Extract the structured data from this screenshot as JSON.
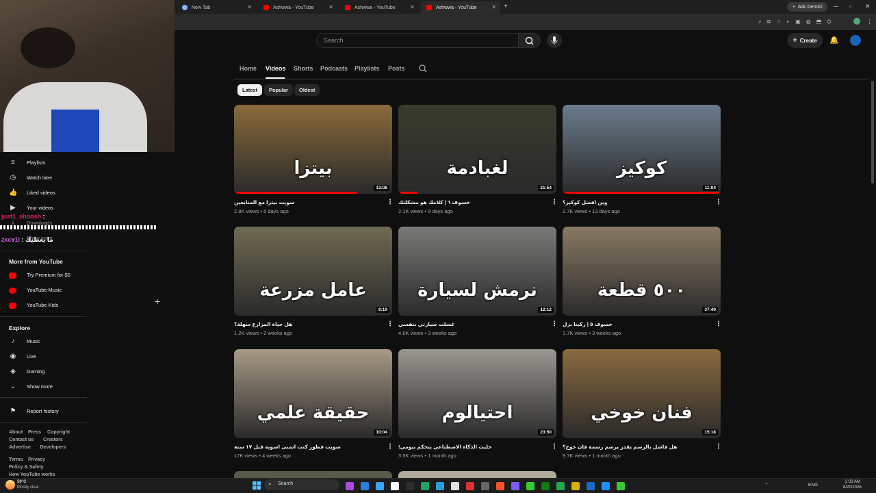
{
  "browser": {
    "tabs": [
      {
        "label": "New Tab",
        "active": false
      },
      {
        "label": "Ashwwa - YouTube",
        "active": false
      },
      {
        "label": "Ashwwa - YouTube",
        "active": false
      },
      {
        "label": "Ashwwa - YouTube",
        "active": true
      }
    ],
    "new_tab": "+",
    "ask_gemini": "Ask Gemini"
  },
  "header": {
    "search_placeholder": "Search",
    "create_label": "Create"
  },
  "channel_tabs": [
    "Home",
    "Videos",
    "Shorts",
    "Podcasts",
    "Playlists",
    "Posts"
  ],
  "active_channel_tab": "Videos",
  "chips": [
    "Latest",
    "Popular",
    "Oldest"
  ],
  "active_chip": "Latest",
  "videos": [
    {
      "overlay": "بيتزا",
      "duration": "13:08",
      "title": "سويت بيتزا مع المتابعين",
      "views": "2.8K views",
      "ago": "5 days ago",
      "thumb_color": "#8a6a3a",
      "progress": 0.78
    },
    {
      "overlay": "لغبادمة",
      "duration": "21:54",
      "title": "خسوف ٦ | كلامك هو مشكلتك",
      "views": "2.1K views",
      "ago": "9 days ago",
      "thumb_color": "#3a3b2e",
      "progress": 0.12
    },
    {
      "overlay": "كوكيز",
      "duration": "11:04",
      "title": "وين افضل كوكيز؟",
      "views": "2.7K views",
      "ago": "13 days ago",
      "thumb_color": "#6b7c8c",
      "progress": 1.0
    },
    {
      "overlay": "عامل مزرعة",
      "duration": "8:19",
      "title": "هل حياة المزارع سهلة؟",
      "views": "1.2K views",
      "ago": "2 weeks ago",
      "thumb_color": "#6f6a52",
      "progress": 0
    },
    {
      "overlay": "نرمش لسيارة",
      "duration": "12:12",
      "title": "غسلت سيارتي بنفسي",
      "views": "4.6K views",
      "ago": "3 weeks ago",
      "thumb_color": "#7a7a78",
      "progress": 0
    },
    {
      "overlay": "٥٠٠ قطعة",
      "duration": "37:49",
      "title": "خسوف ٥ | ركبنا بزل",
      "views": "1.7K views",
      "ago": "3 weeks ago",
      "thumb_color": "#8a7a64",
      "progress": 0
    },
    {
      "overlay": "حقيقة علمي",
      "duration": "10:04",
      "title": "سويت فطور كنت اتمنى اسويه قبل ١٧ سنة",
      "views": "17K views",
      "ago": "4 weeks ago",
      "thumb_color": "#a89a86",
      "progress": 0
    },
    {
      "overlay": "احتيالوم",
      "duration": "23:50",
      "title": "خليت الذكاء الاصطناعي يتحكم بيومي!",
      "views": "3.5K views",
      "ago": "1 month ago",
      "thumb_color": "#9a9690",
      "progress": 0
    },
    {
      "overlay": "فنان خوخي",
      "duration": "15:18",
      "title": "هل فاشل بالرسم يقدر يرسم رسمة فان جوخ؟",
      "views": "9.7K views",
      "ago": "1 month ago",
      "thumb_color": "#8a6a40",
      "progress": 0
    }
  ],
  "sidebar": {
    "you_items": [
      {
        "label": "Playlists",
        "icon": "≡"
      },
      {
        "label": "Watch later",
        "icon": "◷"
      },
      {
        "label": "Liked videos",
        "icon": "👍"
      },
      {
        "label": "Your videos",
        "icon": "▶"
      },
      {
        "label": "Downloads",
        "icon": "⤓"
      },
      {
        "label": "Show more",
        "icon": "⌄"
      }
    ],
    "more_heading": "More from YouTube",
    "more_items": [
      {
        "label": "Try Premium for $0"
      },
      {
        "label": "YouTube Music"
      },
      {
        "label": "YouTube Kids"
      }
    ],
    "explore_heading": "Explore",
    "explore_items": [
      {
        "label": "Music",
        "icon": "♪"
      },
      {
        "label": "Live",
        "icon": "◉"
      },
      {
        "label": "Gaming",
        "icon": "◈"
      },
      {
        "label": "Show more",
        "icon": "⌄"
      }
    ],
    "report_history": "Report history",
    "footer_row1": [
      "About",
      "Press",
      "Copyright"
    ],
    "footer_row2": [
      "Contact us",
      "Creators"
    ],
    "footer_row3": [
      "Advertise",
      "Developers"
    ],
    "footer_row4": [
      "Terms",
      "Privacy"
    ],
    "footer_row5": [
      "Policy & Safety"
    ],
    "footer_row6": [
      "How YouTube works"
    ]
  },
  "chat": [
    {
      "user": "just1_shoosh",
      "message": ":",
      "user_color": "#e0245e"
    },
    {
      "user": "zxcv1l",
      "message": ": ما يعطيك",
      "user_color": "#c35cd6"
    }
  ],
  "taskbar": {
    "weather_temp": "59°C",
    "weather_desc": "Mostly clear",
    "search_label": "Search",
    "lang": "ENG",
    "time": "2:03 AM",
    "date": "8/20/2026"
  }
}
